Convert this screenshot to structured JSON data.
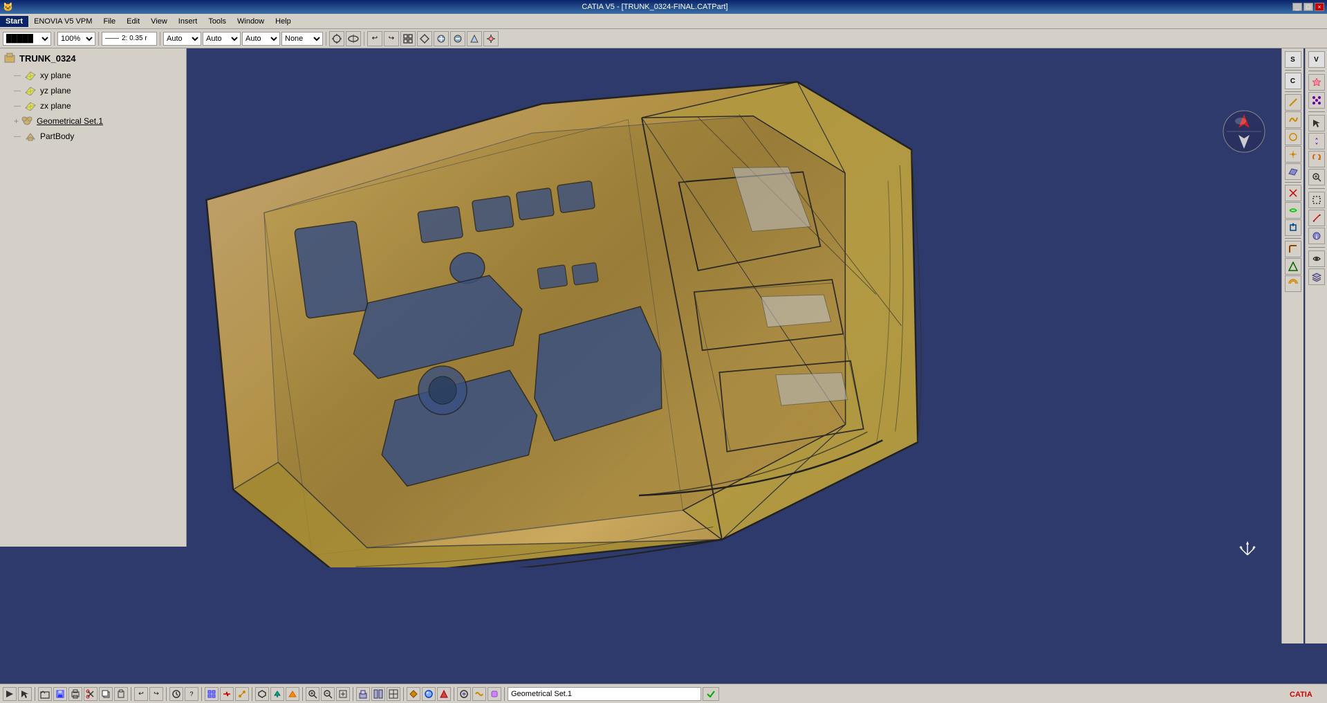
{
  "titlebar": {
    "title": "CATIA V5 - [TRUNK_0324-FINAL.CATPart]",
    "controls": [
      "_",
      "□",
      "×"
    ]
  },
  "menubar": {
    "items": [
      "Start",
      "ENOVIA V5 VPM",
      "File",
      "Edit",
      "View",
      "Insert",
      "Tools",
      "Window",
      "Help"
    ]
  },
  "toolbar": {
    "zoom_value": "100%",
    "line_width": "2: 0.35 r",
    "dropdowns": [
      "Auto",
      "Auto",
      "Auto",
      "None"
    ]
  },
  "tree": {
    "root_label": "TRUNK_0324",
    "items": [
      {
        "label": "xy plane",
        "type": "plane",
        "indent": 1
      },
      {
        "label": "yz plane",
        "type": "plane",
        "indent": 1
      },
      {
        "label": "zx plane",
        "type": "plane",
        "indent": 1
      },
      {
        "label": "Geometrical Set.1",
        "type": "geoset",
        "indent": 1,
        "underline": true
      },
      {
        "label": "PartBody",
        "type": "partbody",
        "indent": 1
      }
    ]
  },
  "status_bar": {
    "active_label": "Geometrical Set.1"
  },
  "coord": {
    "display": "↗"
  },
  "toolbar_icons": {
    "main": [
      "⚙",
      "🔍",
      "↩",
      "↪",
      "↺",
      "↻",
      "⊞",
      "⊠",
      "⊡",
      "⊟",
      "⊞"
    ],
    "right1": [
      "V",
      "★",
      "☆",
      "●",
      "◉",
      "○",
      "□",
      "■",
      "◆",
      "◇",
      "▲",
      "△",
      "▽",
      "▼",
      "✕",
      "✓",
      "⊕",
      "⊗",
      "⊖",
      "⊘",
      "⊙"
    ],
    "right2": [
      "S",
      "C",
      "↗",
      "↘",
      "↙",
      "↖",
      "⟳",
      "⟲",
      "↕",
      "↔",
      "⟷",
      "⟺",
      "↑",
      "↓",
      "←",
      "→"
    ]
  },
  "bottom_icons": [
    "💾",
    "📂",
    "🖨",
    "✂",
    "📋",
    "📌",
    "↩",
    "↪",
    "🔍",
    "⊕",
    "⊖",
    "⊞",
    "⊠",
    "⊡",
    "◻",
    "◼",
    "⊕",
    "⊗",
    "⊖",
    "⊘",
    "⊙"
  ]
}
